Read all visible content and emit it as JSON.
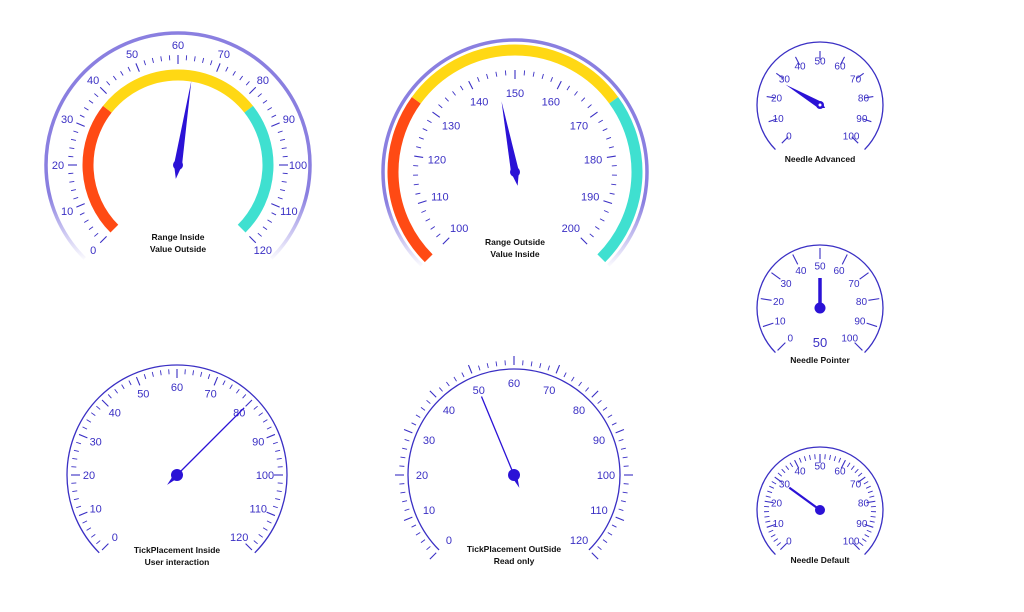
{
  "colors": {
    "accent": "#3a2fc4",
    "needle": "#2b12d6",
    "range_red": "#ff4a14",
    "range_yellow": "#ffd814",
    "range_cyan": "#3fe0d0",
    "ring": "#8a7fe0"
  },
  "gauges": [
    {
      "id": "range-inside",
      "caption_line1": "Range Inside",
      "caption_line2": "Value Outside",
      "min": 0,
      "max": 120,
      "labels": [
        "0",
        "10",
        "20",
        "30",
        "40",
        "50",
        "60",
        "70",
        "80",
        "90",
        "100",
        "110",
        "120"
      ],
      "value": 64,
      "needle_style": "tapered",
      "ranges_placement": "inside",
      "ranges": [
        {
          "from": 0,
          "to": 37,
          "color": "range_red"
        },
        {
          "from": 37,
          "to": 83,
          "color": "range_yellow"
        },
        {
          "from": 83,
          "to": 120,
          "color": "range_cyan"
        }
      ]
    },
    {
      "id": "range-outside",
      "caption_line1": "Range Outside",
      "caption_line2": "Value Inside",
      "min": 100,
      "max": 200,
      "labels": [
        "100",
        "110",
        "120",
        "130",
        "140",
        "150",
        "160",
        "170",
        "180",
        "190",
        "200"
      ],
      "value": 146,
      "needle_style": "tapered",
      "ranges_placement": "outside",
      "ranges": [
        {
          "from": 100,
          "to": 130,
          "color": "range_red"
        },
        {
          "from": 130,
          "to": 170,
          "color": "range_yellow"
        },
        {
          "from": 170,
          "to": 200,
          "color": "range_cyan"
        }
      ]
    },
    {
      "id": "needle-advanced",
      "caption_line1": "Needle Advanced",
      "caption_line2": "",
      "min": 0,
      "max": 100,
      "labels": [
        "0",
        "10",
        "20",
        "30",
        "40",
        "50",
        "60",
        "70",
        "80",
        "90",
        "100"
      ],
      "value": 28,
      "needle_style": "advanced",
      "ranges": []
    },
    {
      "id": "needle-pointer",
      "caption_line1": "Needle Pointer",
      "caption_line2": "",
      "value_text": "50",
      "min": 0,
      "max": 100,
      "labels": [
        "0",
        "10",
        "20",
        "30",
        "40",
        "50",
        "60",
        "70",
        "80",
        "90",
        "100"
      ],
      "value": 50,
      "needle_style": "pointer",
      "ranges": []
    },
    {
      "id": "tickplacement-inside",
      "caption_line1": "TickPlacement Inside",
      "caption_line2": "User interaction",
      "min": 0,
      "max": 120,
      "labels": [
        "0",
        "10",
        "20",
        "30",
        "40",
        "50",
        "60",
        "70",
        "80",
        "90",
        "100",
        "110",
        "120"
      ],
      "value": 80,
      "needle_style": "line",
      "ranges": []
    },
    {
      "id": "tickplacement-outside",
      "caption_line1": "TickPlacement OutSide",
      "caption_line2": "Read only",
      "min": 0,
      "max": 120,
      "labels": [
        "0",
        "10",
        "20",
        "30",
        "40",
        "50",
        "60",
        "70",
        "80",
        "90",
        "100",
        "110",
        "120"
      ],
      "value": 50,
      "needle_style": "line",
      "ranges": []
    },
    {
      "id": "needle-default",
      "caption_line1": "Needle Default",
      "caption_line2": "",
      "min": 0,
      "max": 100,
      "labels": [
        "0",
        "10",
        "20",
        "30",
        "40",
        "50",
        "60",
        "70",
        "80",
        "90",
        "100"
      ],
      "value": 30,
      "needle_style": "default",
      "ranges": []
    }
  ]
}
